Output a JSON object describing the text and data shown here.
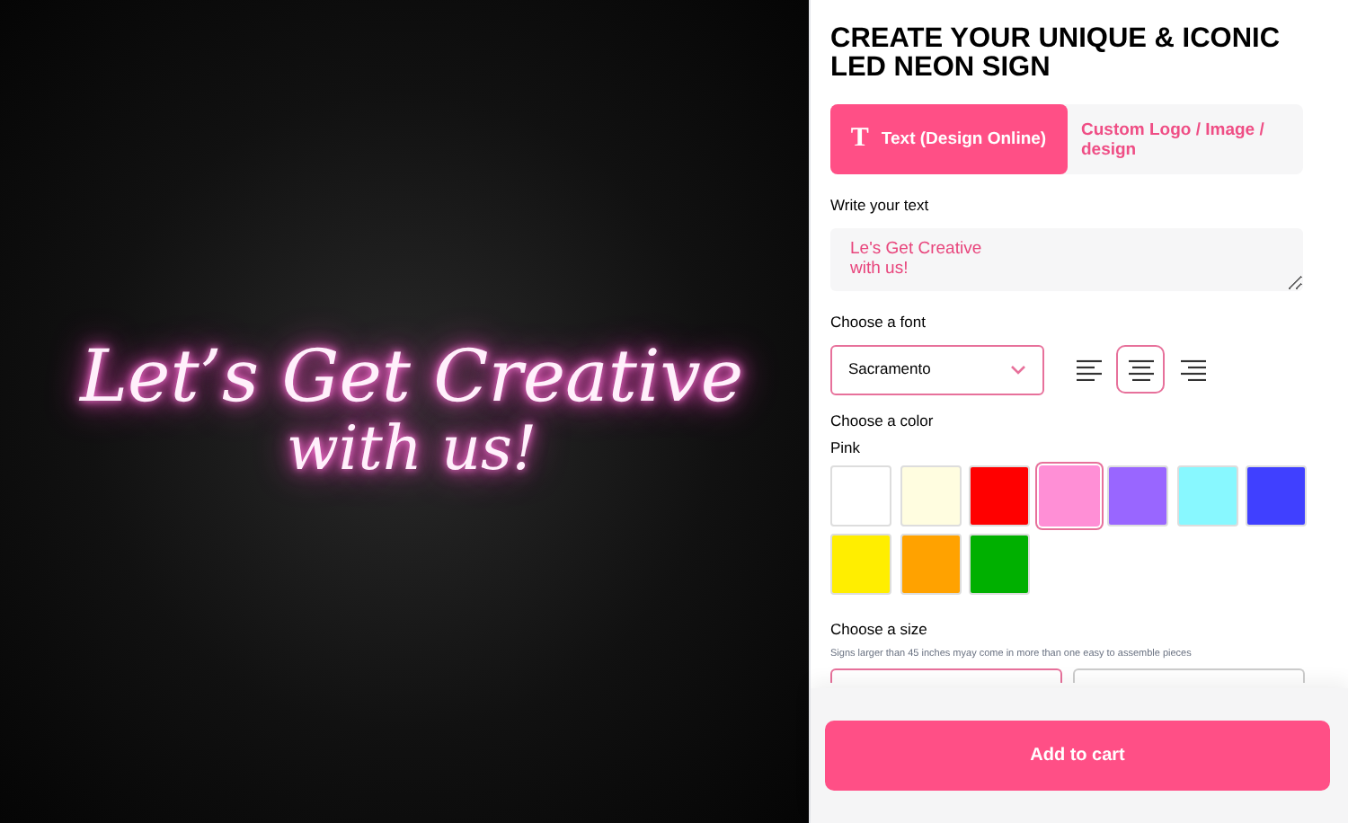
{
  "preview": {
    "lines": [
      "Let’s Get Creative",
      "with us!"
    ]
  },
  "title": "CREATE YOUR UNIQUE & ICONIC LED NEON SIGN",
  "tabs": [
    {
      "label": "Text (Design Online)",
      "icon": "T",
      "selected": true
    },
    {
      "label": "Custom Logo / Image / design",
      "selected": false
    }
  ],
  "text_section": {
    "label": "Write your text",
    "value": "Le's Get Creative\nwith us!"
  },
  "font_section": {
    "label": "Choose a font",
    "value": "Sacramento"
  },
  "alignment": [
    {
      "kind": "left",
      "selected": false
    },
    {
      "kind": "center",
      "selected": true
    },
    {
      "kind": "right",
      "selected": false
    }
  ],
  "color_section": {
    "label": "Choose a color",
    "chosen": "Pink"
  },
  "colors": [
    {
      "color": "#ffffff",
      "selected": false
    },
    {
      "color": "#fffde0",
      "selected": false
    },
    {
      "color": "#ff0000",
      "selected": false
    },
    {
      "color": "#ff8fd6",
      "selected": true
    },
    {
      "color": "#9966ff",
      "selected": false
    },
    {
      "color": "#88f8ff",
      "selected": false
    },
    {
      "color": "#4040ff",
      "selected": false
    },
    {
      "color": "#ffee00",
      "selected": false
    },
    {
      "color": "#ffa200",
      "selected": false
    },
    {
      "color": "#00b000",
      "selected": false
    }
  ],
  "size_section": {
    "label": "Choose a size",
    "note": "Signs larger than 45 inches myay come in more than one easy to assemble pieces"
  },
  "sizes": [
    {
      "selected": true
    },
    {
      "selected": false
    }
  ],
  "cart_button": "Add to cart"
}
